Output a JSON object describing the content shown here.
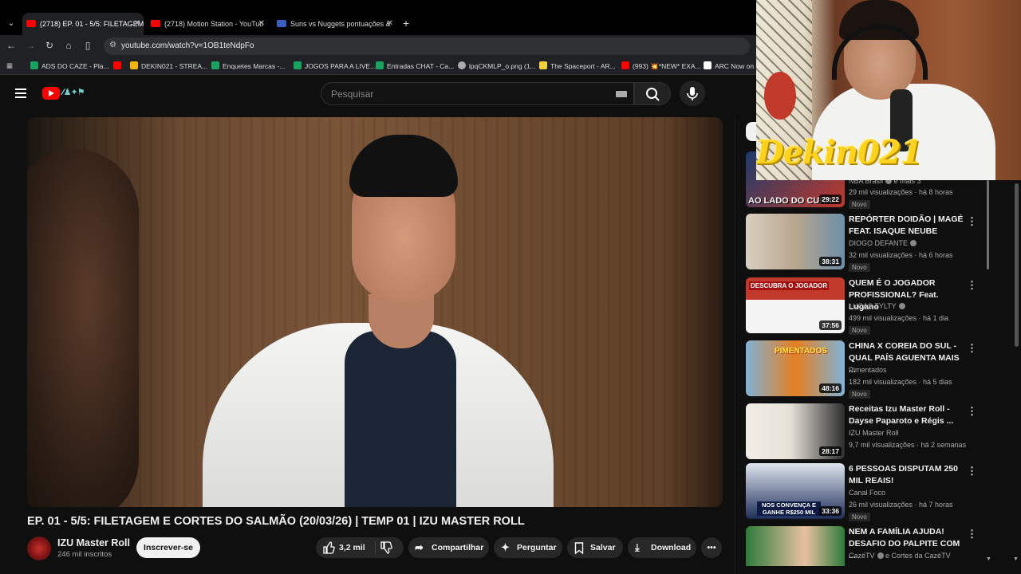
{
  "browser": {
    "tabs": [
      {
        "title": "(2718) EP. 01 - 5/5: FILETAGEM",
        "active": true,
        "favicon": "youtube-icon"
      },
      {
        "title": "(2718) Motion Station - YouTub",
        "active": false,
        "favicon": "youtube-icon"
      },
      {
        "title": "Suns vs Nuggets pontuações &",
        "active": false,
        "favicon": "sports-icon"
      }
    ],
    "url": "youtube.com/watch?v=1OB1teNdpFo",
    "bookmarks": [
      {
        "label": "ADS DO CAZE - Pla...",
        "color": "#1aa260"
      },
      {
        "label": "DEKIN021 - STREA...",
        "color": "#f4b400"
      },
      {
        "label": "Enquetes Marcas -...",
        "color": "#1aa260"
      },
      {
        "label": "JOGOS PARA A LIVE...",
        "color": "#1aa260"
      },
      {
        "label": "Entradas CHAT - Ca...",
        "color": "#1aa260"
      },
      {
        "label": "lpqCKMLP_o.png (1...",
        "color": "#aaaaaa"
      },
      {
        "label": "The Spaceport - AR...",
        "color": "#f4d03f"
      },
      {
        "label": "(993) 💥*NEW* EXA...",
        "color": "#ff0000"
      },
      {
        "label": "ARC Now on X:",
        "color": "#ffffff"
      }
    ]
  },
  "youtube": {
    "search_placeholder": "Pesquisar",
    "video": {
      "title": "EP. 01 - 5/5: FILETAGEM E CORTES DO SALMÃO (20/03/26) | TEMP 01 | IZU MASTER ROLL",
      "channel": "IZU Master Roll",
      "subscribers": "246 mil inscritos",
      "subscribe_label": "Inscrever-se",
      "likes": "3,2 mil",
      "share_label": "Compartilhar",
      "ask_label": "Perguntar",
      "save_label": "Salvar",
      "download_label": "Download"
    },
    "recommendations": [
      {
        "title": "",
        "channel": "NBA Brasil",
        "extra": "e mais 3",
        "meta": "29 mil visualizações · há 8 horas",
        "badge": "Novo",
        "duration": "29:22",
        "thumb_text": "AO LADO DO CURR",
        "colors": [
          "#1d3a6b",
          "#c0392b"
        ]
      },
      {
        "title": "REPÓRTER DOIDÃO | MAGÉ FEAT. ISAQUE NEUBE",
        "channel": "DIOGO DEFANTE",
        "meta": "32 mil visualizações · há 6 horas",
        "badge": "Novo",
        "duration": "38:31",
        "thumb_text": "",
        "colors": [
          "#d9cfc0",
          "#6d8fa8"
        ]
      },
      {
        "title": "QUEM É O JOGADOR PROFISSIONAL? Feat. Lugano",
        "channel": "LUCAS TYLTY",
        "meta": "499 mil visualizações · há 1 dia",
        "badge": "Novo",
        "duration": "37:56",
        "thumb_text": "DESCUBRA O JOGADOR",
        "colors": [
          "#c0392b",
          "#f4f4f4"
        ]
      },
      {
        "title": "CHINA X COREIA DO SUL - QUAL PAÍS AGUENTA MAIS ...",
        "channel": "Pimentados",
        "meta": "182 mil visualizações · há 5 dias",
        "badge": "Novo",
        "duration": "48:16",
        "thumb_text": "PIMENTADOS",
        "colors": [
          "#7fb3d5",
          "#e67e22"
        ]
      },
      {
        "title": "Receitas Izu Master Roll - Dayse Paparoto e Régis ...",
        "channel": "IZU Master Roll",
        "meta": "9,7 mil visualizações · há 2 semanas",
        "badge": "",
        "duration": "28:17",
        "thumb_text": "",
        "colors": [
          "#f0ede6",
          "#2c2c2c"
        ]
      },
      {
        "title": "6 PESSOAS DISPUTAM 250 MIL REAIS!",
        "channel": "Canal Foco",
        "meta": "26 mil visualizações · há 7 horas",
        "badge": "Novo",
        "duration": "33:36",
        "thumb_text": "NOS CONVENÇA E GANHE R$250 MIL",
        "colors": [
          "#dfe6ee",
          "#1f2d5a"
        ]
      },
      {
        "title": "NEM A FAMÍLIA AJUDA! DESAFIO DO PALPITE COM ...",
        "channel": "CazéTV",
        "extra": "e Cortes da CazéTV",
        "meta": "",
        "badge": "",
        "duration": "",
        "thumb_text": "",
        "colors": [
          "#2d7a3a",
          "#e8c1a0"
        ]
      }
    ]
  },
  "webcam": {
    "streamer_tag": "Dekin021"
  }
}
